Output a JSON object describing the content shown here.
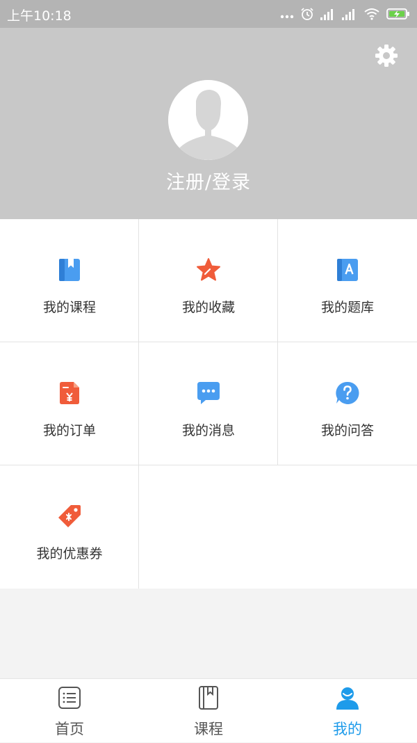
{
  "status_bar": {
    "time": "上午10:18",
    "icons": [
      "more-dots-icon",
      "alarm-icon",
      "signal-icon",
      "signal-icon",
      "wifi-icon",
      "battery-charging-icon"
    ]
  },
  "profile": {
    "login_label": "注册/登录",
    "avatar_icon": "default-avatar-icon",
    "settings_icon": "gear-icon"
  },
  "menu": {
    "items": [
      {
        "label": "我的课程",
        "icon": "course-book-icon",
        "color": "#4a9df0"
      },
      {
        "label": "我的收藏",
        "icon": "star-icon",
        "color": "#f05c3a"
      },
      {
        "label": "我的题库",
        "icon": "question-bank-icon",
        "color": "#4a9df0"
      },
      {
        "label": "我的订单",
        "icon": "order-document-icon",
        "color": "#f05c3a"
      },
      {
        "label": "我的消息",
        "icon": "message-bubble-icon",
        "color": "#4a9df0"
      },
      {
        "label": "我的问答",
        "icon": "question-circle-icon",
        "color": "#4a9df0"
      },
      {
        "label": "我的优惠券",
        "icon": "coupon-tag-icon",
        "color": "#f05c3a"
      }
    ]
  },
  "tab_bar": {
    "items": [
      {
        "label": "首页",
        "icon": "home-list-icon",
        "active": false
      },
      {
        "label": "课程",
        "icon": "course-book-icon",
        "active": false
      },
      {
        "label": "我的",
        "icon": "user-profile-icon",
        "active": true
      }
    ],
    "active_color": "#1e9bea",
    "inactive_color": "#555555"
  },
  "colors": {
    "header_bg": "#c8c8c8",
    "status_bar_bg": "#b4b4b4",
    "page_bg": "#f3f3f3"
  }
}
